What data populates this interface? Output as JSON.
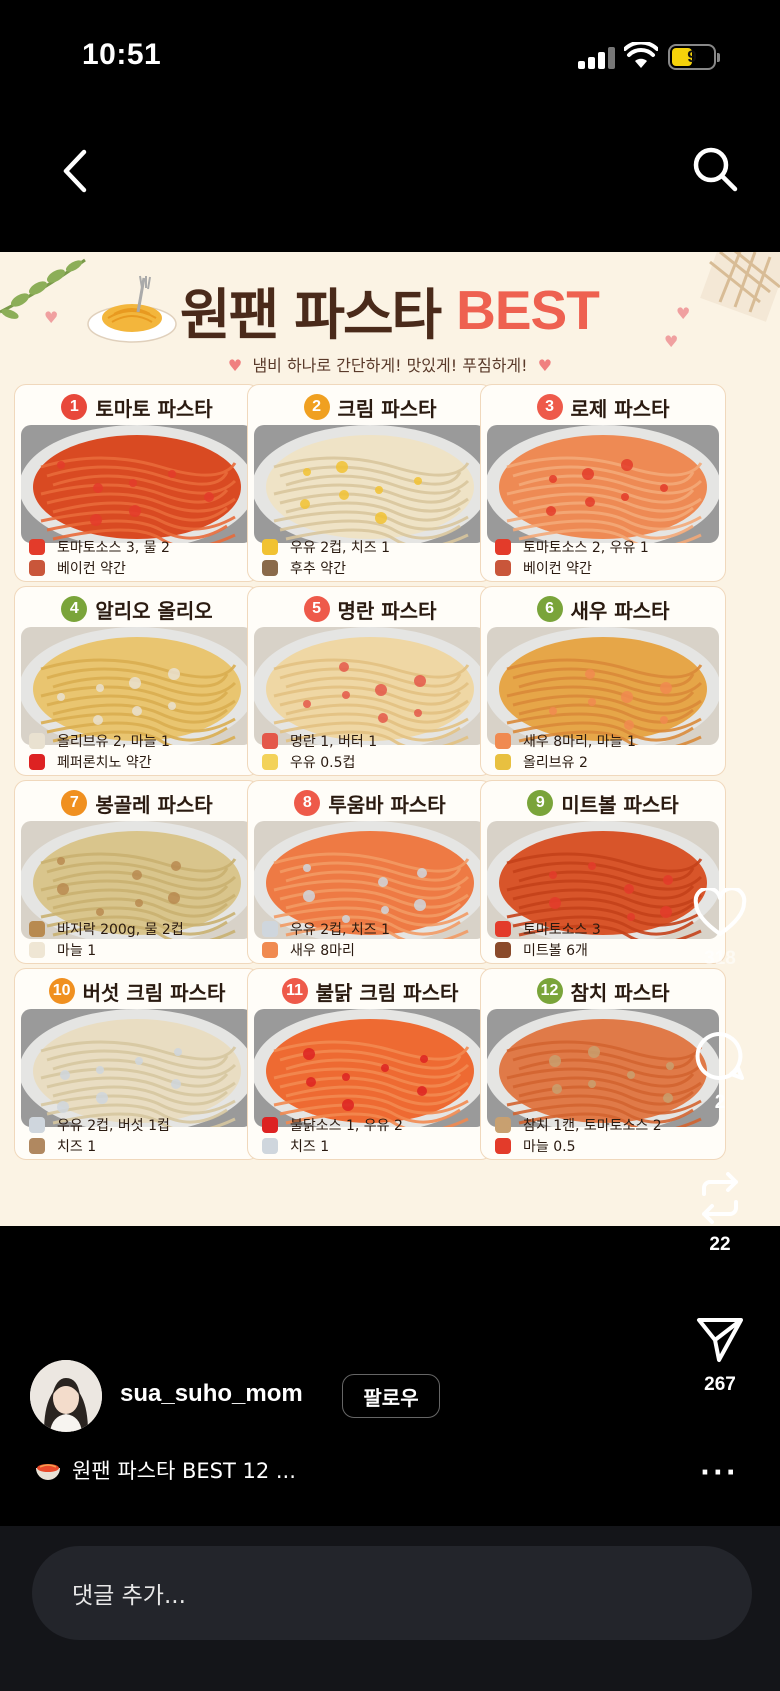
{
  "status": {
    "time": "10:51",
    "battery": "9"
  },
  "nav": {
    "back_icon": "chevron-left-icon",
    "search_icon": "search-icon"
  },
  "post": {
    "title_main": "원팬 파스타",
    "title_accent": "BEST",
    "subtitle": "냄비 하나로 간단하게! 맛있게! 푸짐하게!",
    "cards": [
      {
        "num": "1",
        "name": "토마토 파스타",
        "ing1": "토마토소스 3, 물 2",
        "ing2": "베이컨 약간"
      },
      {
        "num": "2",
        "name": "크림 파스타",
        "ing1": "우유 2컵, 치즈 1",
        "ing2": "후추 약간"
      },
      {
        "num": "3",
        "name": "로제 파스타",
        "ing1": "토마토소스 2, 우유 1",
        "ing2": "베이컨 약간"
      },
      {
        "num": "4",
        "name": "알리오 올리오",
        "ing1": "올리브유 2, 마늘 1",
        "ing2": "페퍼론치노 약간"
      },
      {
        "num": "5",
        "name": "명란 파스타",
        "ing1": "명란 1, 버터 1",
        "ing2": "우유 0.5컵"
      },
      {
        "num": "6",
        "name": "새우 파스타",
        "ing1": "새우 8마리, 마늘 1",
        "ing2": "올리브유 2"
      },
      {
        "num": "7",
        "name": "봉골레 파스타",
        "ing1": "바지락 200g, 물 2컵",
        "ing2": "마늘 1"
      },
      {
        "num": "8",
        "name": "투움바 파스타",
        "ing1": "우유 2컵, 치즈 1",
        "ing2": "새우 8마리"
      },
      {
        "num": "9",
        "name": "미트볼 파스타",
        "ing1": "토마토소스 3",
        "ing2": "미트볼 6개"
      },
      {
        "num": "10",
        "name": "버섯 크림 파스타",
        "ing1": "우유 2컵, 버섯 1컵",
        "ing2": "치즈 1"
      },
      {
        "num": "11",
        "name": "불닭 크림 파스타",
        "ing1": "불닭소스 1, 우유 2",
        "ing2": "치즈 1"
      },
      {
        "num": "12",
        "name": "참치 파스타",
        "ing1": "참치 1캔, 토마토소스 2",
        "ing2": "마늘 0.5"
      }
    ]
  },
  "actions": {
    "likes": "318",
    "comments": "2",
    "reposts": "22",
    "shares": "267"
  },
  "user": {
    "username": "sua_suho_mom",
    "follow_label": "팔로우"
  },
  "caption": "원팬 파스타 BEST 12 ...",
  "more_label": "···",
  "comment_placeholder": "댓글 추가..."
}
